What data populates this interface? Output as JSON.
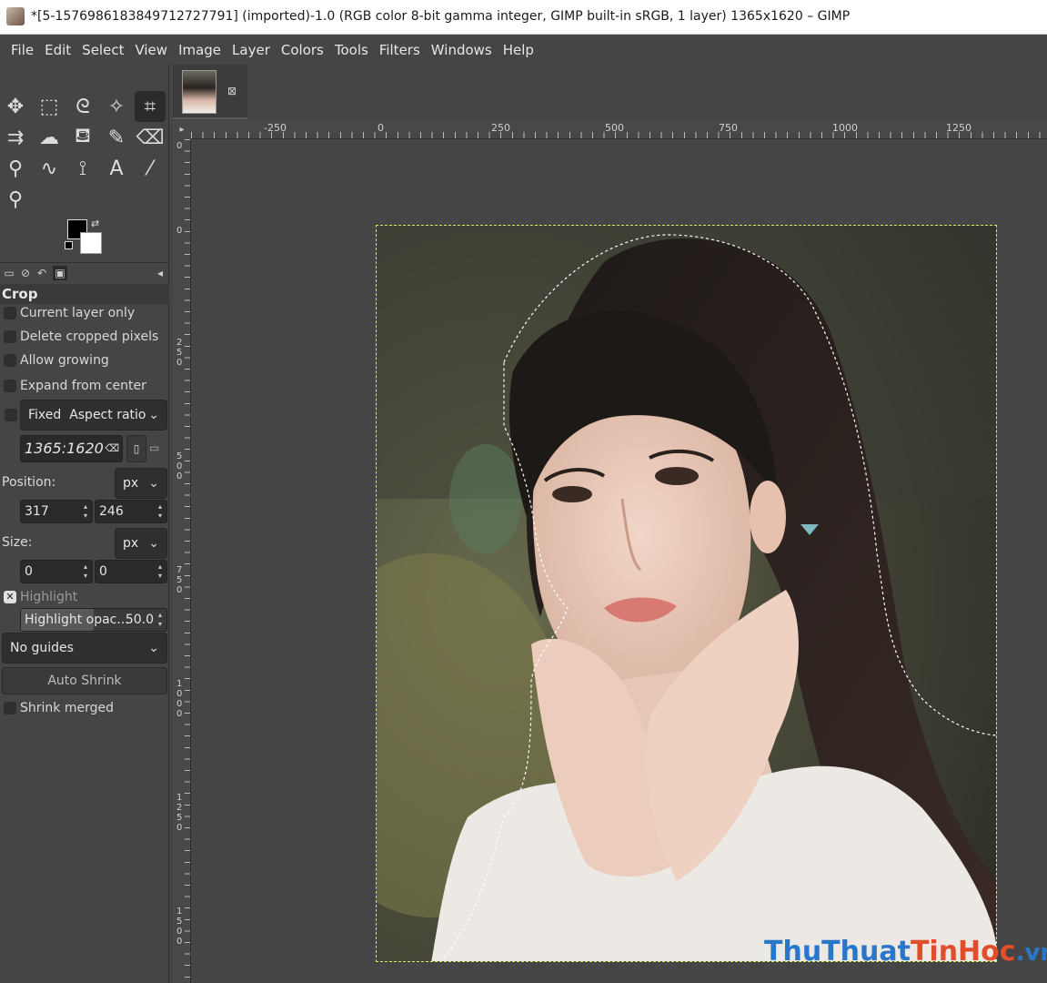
{
  "window": {
    "title": "*[5-1576986183849712727791] (imported)-1.0 (RGB color 8-bit gamma integer, GIMP built-in sRGB, 1 layer) 1365x1620 – GIMP",
    "app_icon": "gimp-image-icon"
  },
  "menu": [
    "File",
    "Edit",
    "Select",
    "View",
    "Image",
    "Layer",
    "Colors",
    "Tools",
    "Filters",
    "Windows",
    "Help"
  ],
  "tools": [
    {
      "name": "move-tool-icon",
      "glyph": "✥"
    },
    {
      "name": "rect-select-tool-icon",
      "glyph": "⬚"
    },
    {
      "name": "free-select-tool-icon",
      "glyph": "ᘓ"
    },
    {
      "name": "fuzzy-select-tool-icon",
      "glyph": "✧"
    },
    {
      "name": "crop-tool-icon",
      "glyph": "⌗",
      "active": true
    },
    {
      "name": "unified-transform-tool-icon",
      "glyph": "⇉"
    },
    {
      "name": "warp-transform-tool-icon",
      "glyph": "☁"
    },
    {
      "name": "bucket-fill-tool-icon",
      "glyph": "⛾"
    },
    {
      "name": "paintbrush-tool-icon",
      "glyph": "✎"
    },
    {
      "name": "eraser-tool-icon",
      "glyph": "⌫"
    },
    {
      "name": "clone-tool-icon",
      "glyph": "⚲"
    },
    {
      "name": "smudge-tool-icon",
      "glyph": "∿"
    },
    {
      "name": "paths-tool-icon",
      "glyph": "⟟"
    },
    {
      "name": "text-tool-icon",
      "glyph": "A"
    },
    {
      "name": "color-picker-tool-icon",
      "glyph": "⁄"
    },
    {
      "name": "zoom-tool-icon",
      "glyph": "⚲"
    }
  ],
  "colors": {
    "foreground": "#000000",
    "background": "#ffffff"
  },
  "tool_options": {
    "title": "Crop",
    "current_layer_only": "Current layer only",
    "delete_cropped_pixels": "Delete cropped pixels",
    "allow_growing": "Allow growing",
    "expand_from_center": "Expand from center",
    "fixed_label": "Fixed",
    "fixed_mode": "Aspect ratio",
    "ratio_value": "1365:1620",
    "position_label": "Position:",
    "position_unit": "px",
    "position_x": "317",
    "position_y": "246",
    "size_label": "Size:",
    "size_unit": "px",
    "size_w": "0",
    "size_h": "0",
    "highlight": "Highlight",
    "highlight_opacity_label": "Highlight opac...",
    "highlight_opacity_value": "50.0",
    "guides": "No guides",
    "auto_shrink": "Auto Shrink",
    "shrink_merged": "Shrink merged"
  },
  "ruler": {
    "top_labels": [
      "-250",
      "0",
      "250",
      "500",
      "750",
      "1000",
      "1250"
    ],
    "left_labels": [
      "0",
      "0",
      "250",
      "500",
      "750",
      "1000",
      "1250",
      "1500"
    ]
  },
  "watermark": {
    "part1": "ThuThuat",
    "part2": "TinHoc",
    "part3": ".vn"
  }
}
